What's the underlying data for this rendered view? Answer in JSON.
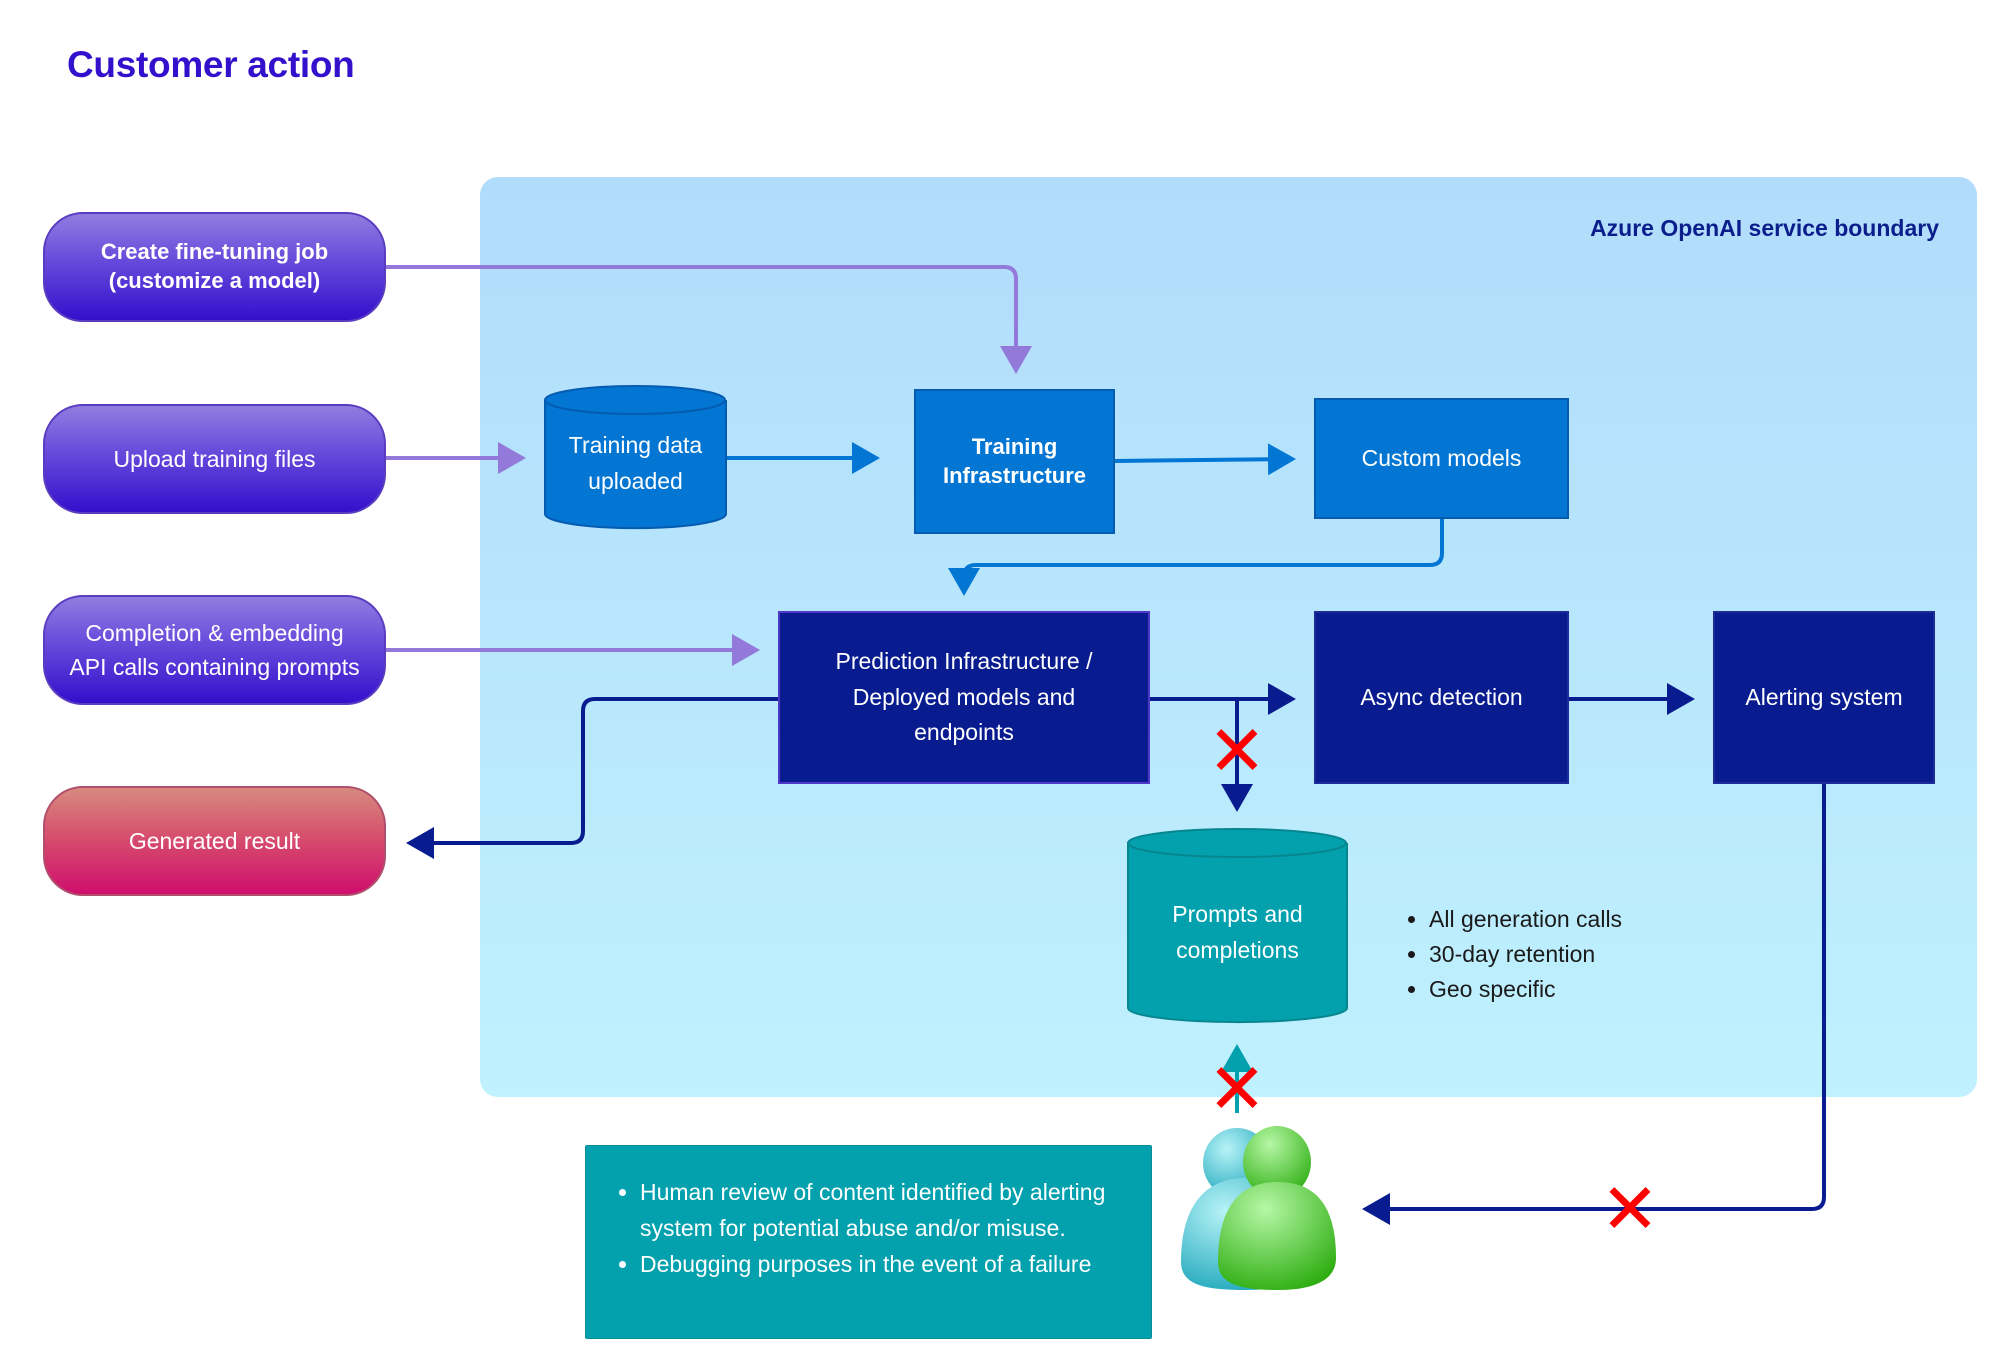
{
  "title": "Customer action",
  "boundary": {
    "label": "Azure OpenAI service boundary"
  },
  "customer_actions": [
    {
      "id": "create-fine-tuning-job",
      "label": "Create fine-tuning job\n(customize a model)"
    },
    {
      "id": "upload-training-files",
      "label": "Upload training files"
    },
    {
      "id": "completion-embedding-calls",
      "label": "Completion & embedding\nAPI calls containing prompts"
    },
    {
      "id": "generated-result",
      "label": "Generated result"
    }
  ],
  "nodes": {
    "training_data": "Training data\nuploaded",
    "training_infrastructure": "Training\nInfrastructure",
    "custom_models": "Custom models",
    "prediction_infrastructure": "Prediction Infrastructure /\nDeployed models and\nendpoints",
    "async_detection": "Async detection",
    "alerting_system": "Alerting system",
    "prompts_completions": "Prompts and\ncompletions"
  },
  "storage_notes": [
    "All generation calls",
    "30-day retention",
    "Geo specific"
  ],
  "human_review_notes": [
    "Human review of content identified by alerting system for potential abuse and/or misuse.",
    "Debugging purposes in the event of a failure"
  ],
  "icons": {
    "blocked_marker": "red-x",
    "reviewer": "people-icon"
  },
  "colors": {
    "title": "#3311cc",
    "customer_action": "#3410cc",
    "generated_result": "#cf0e6d",
    "training_blue": "#0276d2",
    "prediction_navy": "#081b8f",
    "storage_teal": "#02a1ad",
    "boundary_top": "#b1dcfb",
    "boundary_bottom": "#bff1fe",
    "blocked": "#ff0000"
  }
}
